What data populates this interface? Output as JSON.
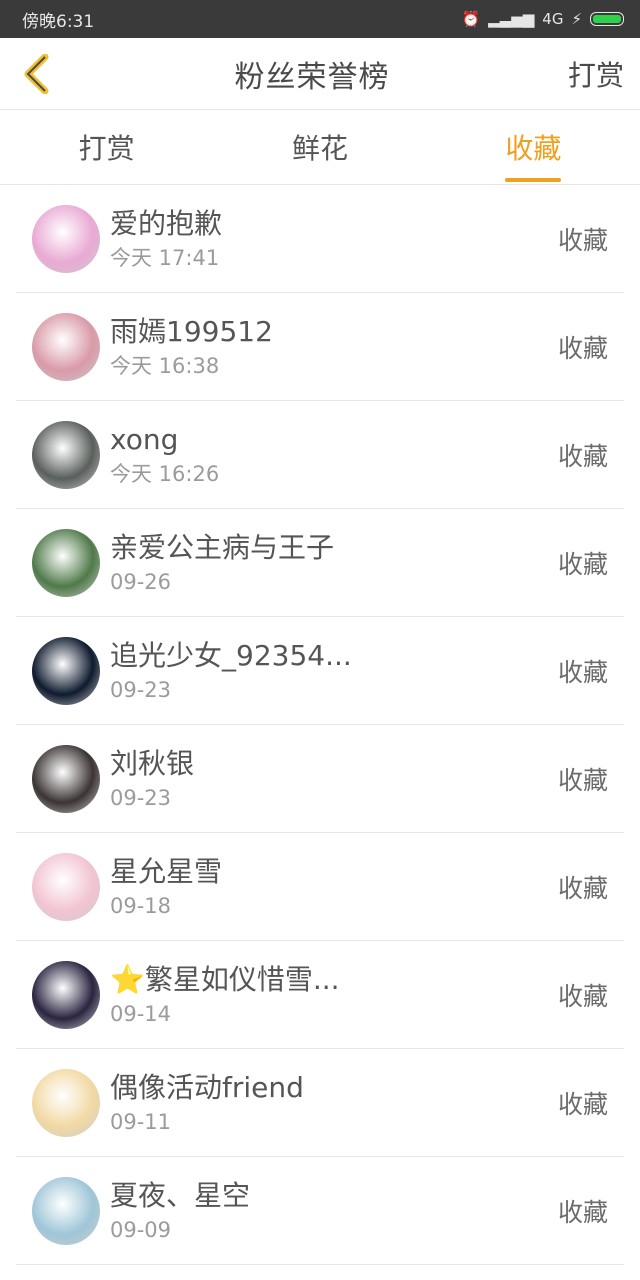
{
  "status": {
    "time": "傍晚6:31",
    "network": "4G"
  },
  "header": {
    "title": "粉丝荣誉榜",
    "right_button": "打赏"
  },
  "tabs": [
    {
      "label": "打赏",
      "active": false
    },
    {
      "label": "鲜花",
      "active": false
    },
    {
      "label": "收藏",
      "active": true
    }
  ],
  "items": [
    {
      "name": "爱的抱歉",
      "time": "今天 17:41",
      "action": "收藏",
      "avatar_color": "#e9a9d4"
    },
    {
      "name": "雨嫣199512",
      "time": "今天 16:38",
      "action": "收藏",
      "avatar_color": "#d99aa8"
    },
    {
      "name": "xong",
      "time": "今天 16:26",
      "action": "收藏",
      "avatar_color": "#5a5f5c"
    },
    {
      "name": "亲爱公主病与王子",
      "time": "09-26",
      "action": "收藏",
      "avatar_color": "#4f7a4a"
    },
    {
      "name": "追光少女_92354...",
      "time": "09-23",
      "action": "收藏",
      "avatar_color": "#0e1a2e"
    },
    {
      "name": "刘秋银",
      "time": "09-23",
      "action": "收藏",
      "avatar_color": "#3c3434"
    },
    {
      "name": "星允星雪",
      "time": "09-18",
      "action": "收藏",
      "avatar_color": "#f2c4d2"
    },
    {
      "name": "⭐繁星如仪惜雪...",
      "time": "09-14",
      "action": "收藏",
      "avatar_color": "#2a2440"
    },
    {
      "name": "偶像活动friend",
      "time": "09-11",
      "action": "收藏",
      "avatar_color": "#f2d9a4"
    },
    {
      "name": "夏夜、星空",
      "time": "09-09",
      "action": "收藏",
      "avatar_color": "#9fc6d8"
    }
  ],
  "colors": {
    "accent": "#f0a020"
  }
}
